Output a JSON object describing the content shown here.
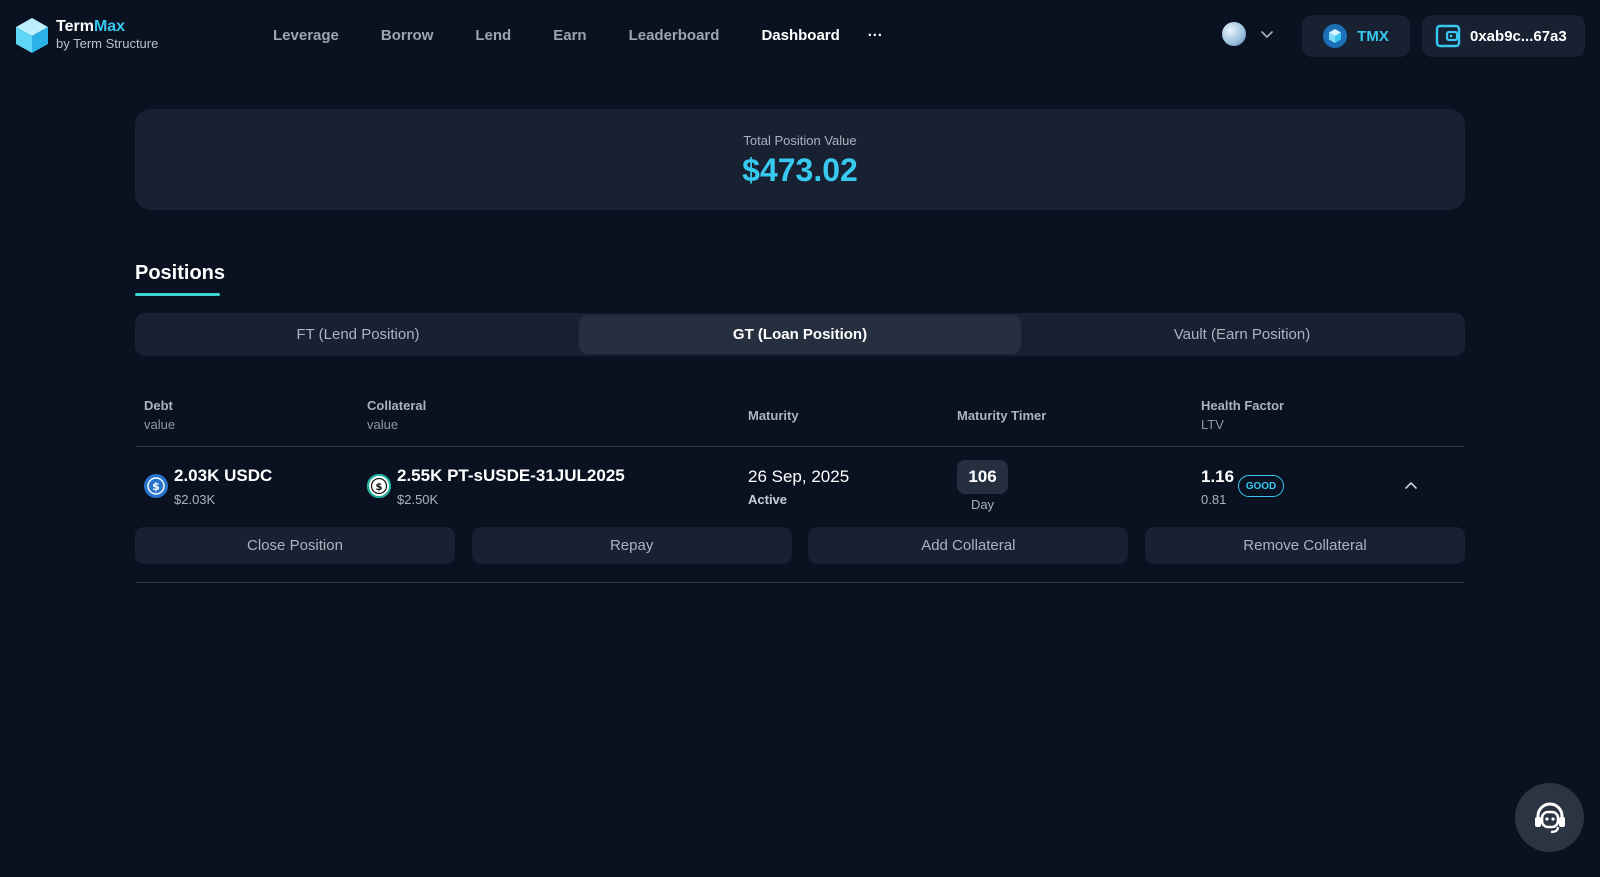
{
  "brand": {
    "name_main": "Term",
    "name_accent": "Max",
    "subtitle": "by Term Structure"
  },
  "nav": {
    "items": [
      "Leverage",
      "Borrow",
      "Lend",
      "Earn",
      "Leaderboard",
      "Dashboard"
    ],
    "active": "Dashboard",
    "more": "···"
  },
  "header": {
    "tmx_label": "TMX",
    "wallet_address": "0xab9c...67a3"
  },
  "summary": {
    "label": "Total Position Value",
    "value": "$473.02"
  },
  "positions": {
    "title": "Positions",
    "tabs": [
      "FT (Lend Position)",
      "GT (Loan Position)",
      "Vault (Earn Position)"
    ],
    "active_tab": "GT (Loan Position)",
    "columns": {
      "debt": {
        "label": "Debt",
        "sub": "value"
      },
      "collateral": {
        "label": "Collateral",
        "sub": "value"
      },
      "maturity": {
        "label": "Maturity"
      },
      "timer": {
        "label": "Maturity Timer"
      },
      "health": {
        "label": "Health Factor",
        "sub": "LTV"
      }
    },
    "rows": [
      {
        "debt_amount": "2.03K USDC",
        "debt_value": "$2.03K",
        "collateral_amount": "2.55K PT-sUSDE-31JUL2025",
        "collateral_value": "$2.50K",
        "maturity_date": "26 Sep, 2025",
        "maturity_status": "Active",
        "timer_value": "106",
        "timer_unit": "Day",
        "health_factor": "1.16",
        "health_badge": "GOOD",
        "ltv": "0.81"
      }
    ],
    "actions": [
      "Close Position",
      "Repay",
      "Add Collateral",
      "Remove Collateral"
    ]
  },
  "icons": {
    "brand": "termmax-cube-logo",
    "language": "globe-icon",
    "tmx": "tmx-cube-icon",
    "wallet": "wallet-icon",
    "debt_token": "usdc-coin-icon",
    "collateral_token": "susde-coin-icon",
    "collapse": "chevron-up-icon",
    "support": "headset-support-icon"
  },
  "colors": {
    "background": "#0a1120",
    "card": "#172131",
    "accent": "#38c9f0",
    "tab_underline": "#3ad6d2",
    "usdc": "#2775ca"
  }
}
